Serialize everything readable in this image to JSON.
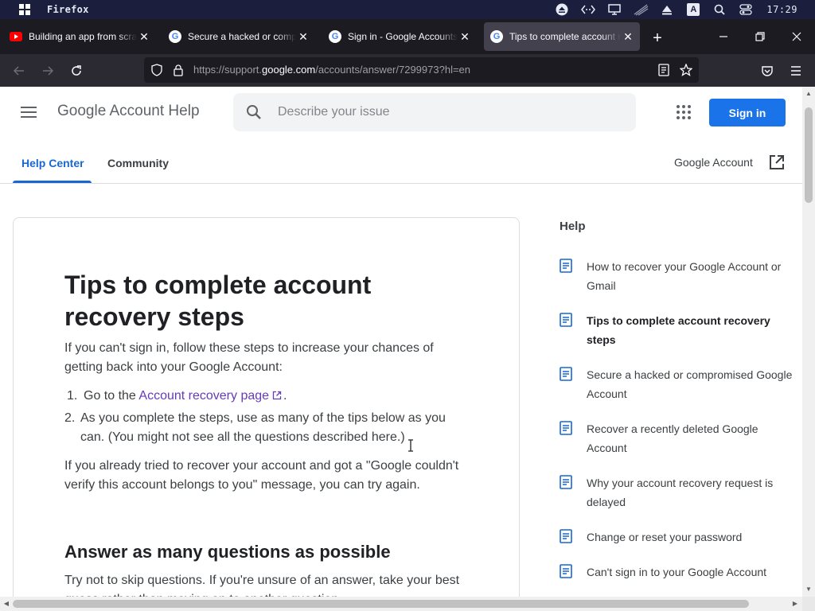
{
  "os": {
    "app_name": "Firefox",
    "time": "17:29",
    "tray_keyboard": "A"
  },
  "browser": {
    "tabs": [
      {
        "title": "Building an app from scratch",
        "favicon": "youtube-icon"
      },
      {
        "title": "Secure a hacked or compromised",
        "favicon": "google-icon"
      },
      {
        "title": "Sign in - Google Accounts",
        "favicon": "google-icon"
      },
      {
        "title": "Tips to complete account recovery",
        "favicon": "google-icon",
        "active": true
      }
    ],
    "url_prefix": "https://support.",
    "url_host": "google.com",
    "url_path": "/accounts/answer/7299973?hl=en"
  },
  "header": {
    "brand": "Google Account Help",
    "search_placeholder": "Describe your issue",
    "signin_label": "Sign in"
  },
  "page_tabs": {
    "help_center": "Help Center",
    "community": "Community",
    "google_account": "Google Account"
  },
  "article": {
    "title": "Tips to complete account recovery steps",
    "intro": "If you can't sign in, follow these steps to increase your chances of getting back into your Google Account:",
    "step1_num": "1.",
    "step1_prefix": "Go to the",
    "step1_link": "Account recovery page",
    "step1_suffix": ".",
    "step2_num": "2.",
    "step2": "As you complete the steps, use as many of the tips below as you can. (You might not see all the questions described here.)",
    "para2": "If you already tried to recover your account and got a \"Google couldn't verify this account belongs to you\" message, you can try again.",
    "h2": "Answer as many questions as possible",
    "para3": "Try not to skip questions. If you're unsure of an answer, take your best guess rather than moving on to another question."
  },
  "sidebar": {
    "title": "Help",
    "items": [
      {
        "label": "How to recover your Google Account or Gmail"
      },
      {
        "label": "Tips to complete account recovery steps",
        "current": true
      },
      {
        "label": "Secure a hacked or compromised Google Account"
      },
      {
        "label": "Recover a recently deleted Google Account"
      },
      {
        "label": "Why your account recovery request is delayed"
      },
      {
        "label": "Change or reset your password"
      },
      {
        "label": "Can't sign in to your Google Account"
      }
    ]
  },
  "colors": {
    "accent": "#1a73e8",
    "link": "#673ab7",
    "tab_active": "#1967d2"
  }
}
